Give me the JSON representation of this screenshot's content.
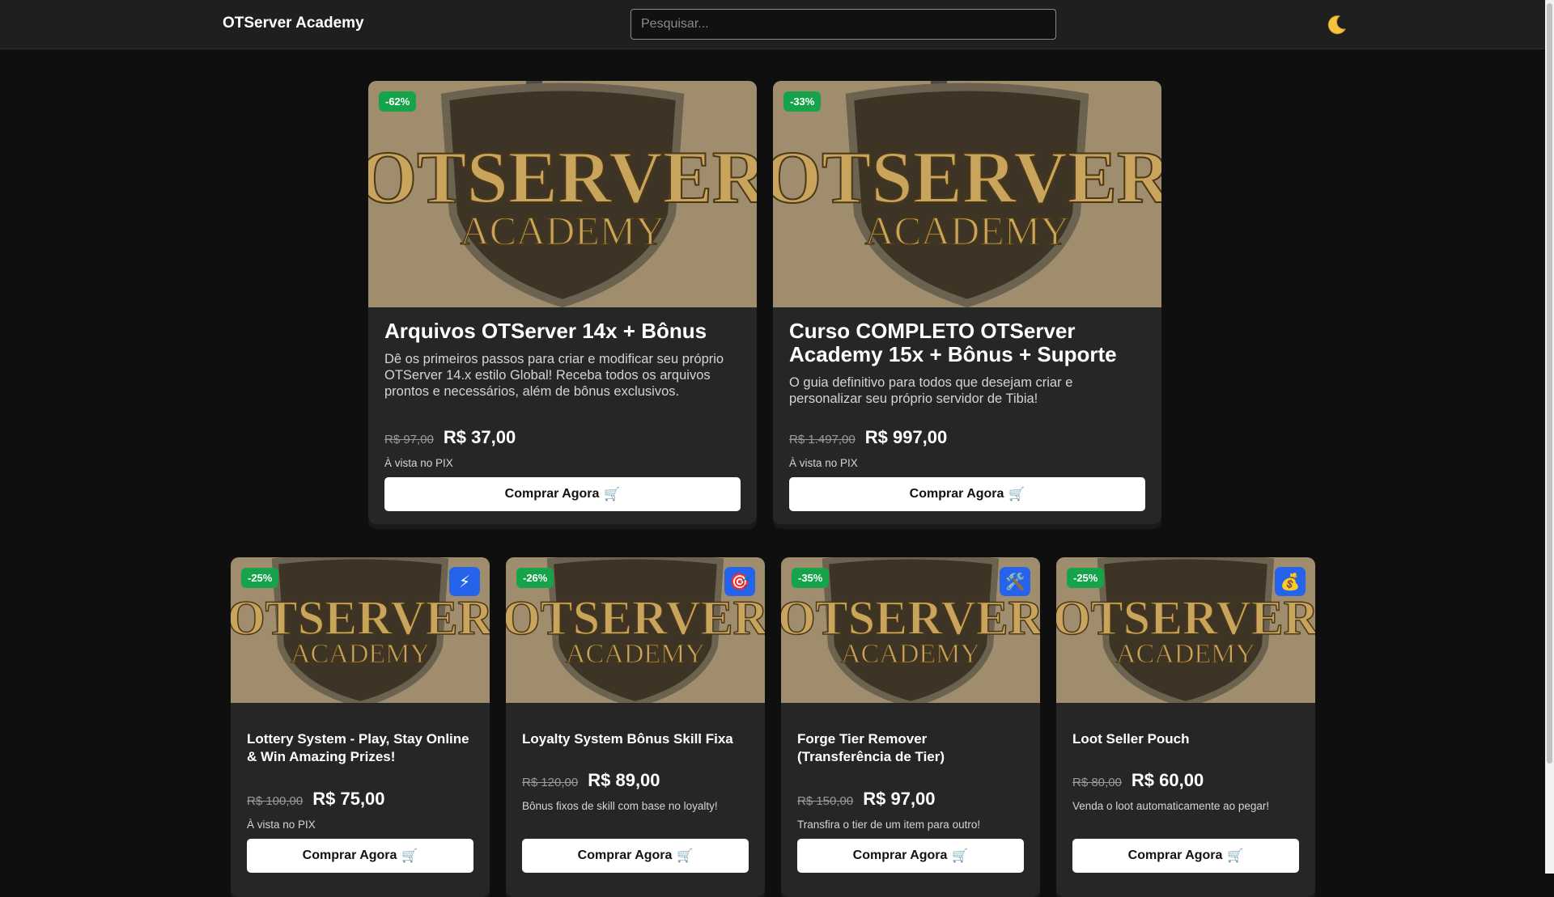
{
  "header": {
    "brand": "OTServer Academy",
    "search_placeholder": "Pesquisar...",
    "theme_icon": "🌙"
  },
  "shared": {
    "buy_label": "Comprar Agora",
    "cart_icon": "🛒",
    "logo_line1": "OTSERVER",
    "logo_line2": "ACADEMY"
  },
  "featured": [
    {
      "discount": "-62%",
      "title": "Arquivos OTServer 14x + Bônus",
      "description": "Dê os primeiros passos para criar e modificar seu próprio OTServer 14.x estilo Global! Receba todos os arquivos prontos e necessários, além de bônus exclusivos.",
      "old_price": "R$ 97,00",
      "price": "R$ 37,00",
      "note": "À vista no PIX"
    },
    {
      "discount": "-33%",
      "title": "Curso COMPLETO OTServer Academy 15x + Bônus + Suporte",
      "description": "O guia definitivo para todos que desejam criar e personalizar seu próprio servidor de Tibia!",
      "old_price": "R$ 1.497,00",
      "price": "R$ 997,00",
      "note": "À vista no PIX"
    }
  ],
  "products": [
    {
      "discount": "-25%",
      "icon": "⚡",
      "icon_name": "lightning-icon",
      "title": "Lottery System - Play, Stay Online & Win Amazing Prizes!",
      "old_price": "R$ 100,00",
      "price": "R$ 75,00",
      "note": "À vista no PIX"
    },
    {
      "discount": "-26%",
      "icon": "🎯",
      "icon_name": "target-icon",
      "title": "Loyalty System Bônus Skill Fixa",
      "old_price": "R$ 120,00",
      "price": "R$ 89,00",
      "note": "Bônus fixos de skill com base no loyalty!"
    },
    {
      "discount": "-35%",
      "icon": "🛠️",
      "icon_name": "tools-icon",
      "title": "Forge Tier Remover (Transferência de Tier)",
      "old_price": "R$ 150,00",
      "price": "R$ 97,00",
      "note": "Transfira o tier de um item para outro!"
    },
    {
      "discount": "-25%",
      "icon": "💰",
      "icon_name": "money-bag-icon",
      "title": "Loot Seller Pouch",
      "old_price": "R$ 80,00",
      "price": "R$ 60,00",
      "note": "Venda o loot automaticamente ao pegar!"
    }
  ],
  "colors": {
    "background": "#0f0f0f",
    "header": "#1f1f1f",
    "card": "#262626",
    "discount_badge": "#16a34a",
    "icon_badge": "#2563eb",
    "logo_gold": "#c9a45c"
  }
}
